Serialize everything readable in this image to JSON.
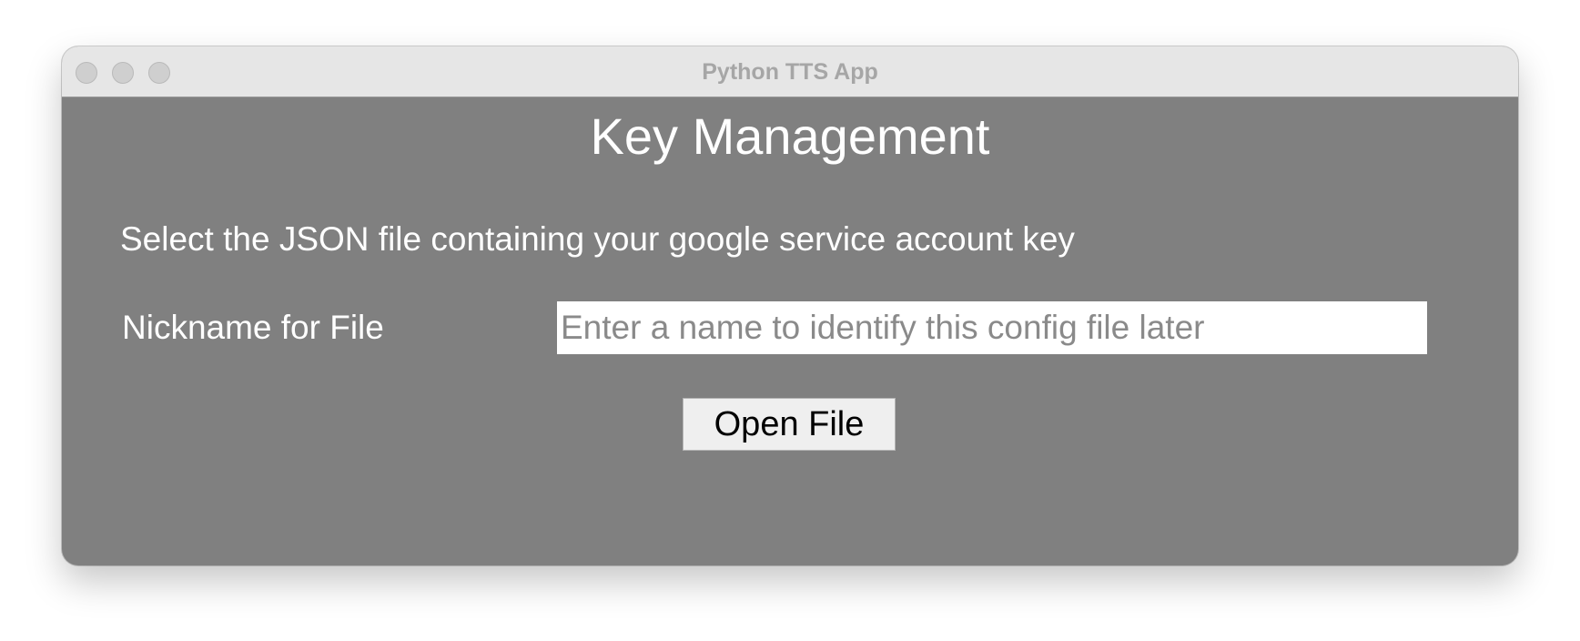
{
  "window": {
    "title": "Python TTS App"
  },
  "main": {
    "heading": "Key Management",
    "instruction": "Select the JSON file containing your google service account key",
    "nickname_label": "Nickname for File",
    "nickname_value": "",
    "nickname_placeholder": "Enter a name to identify this config file later",
    "open_file_label": "Open File"
  },
  "colors": {
    "background": "#808080",
    "titlebar": "#e6e6e6",
    "text": "#ffffff"
  },
  "icons": {
    "close": "close-icon",
    "minimize": "minimize-icon",
    "zoom": "zoom-icon"
  }
}
